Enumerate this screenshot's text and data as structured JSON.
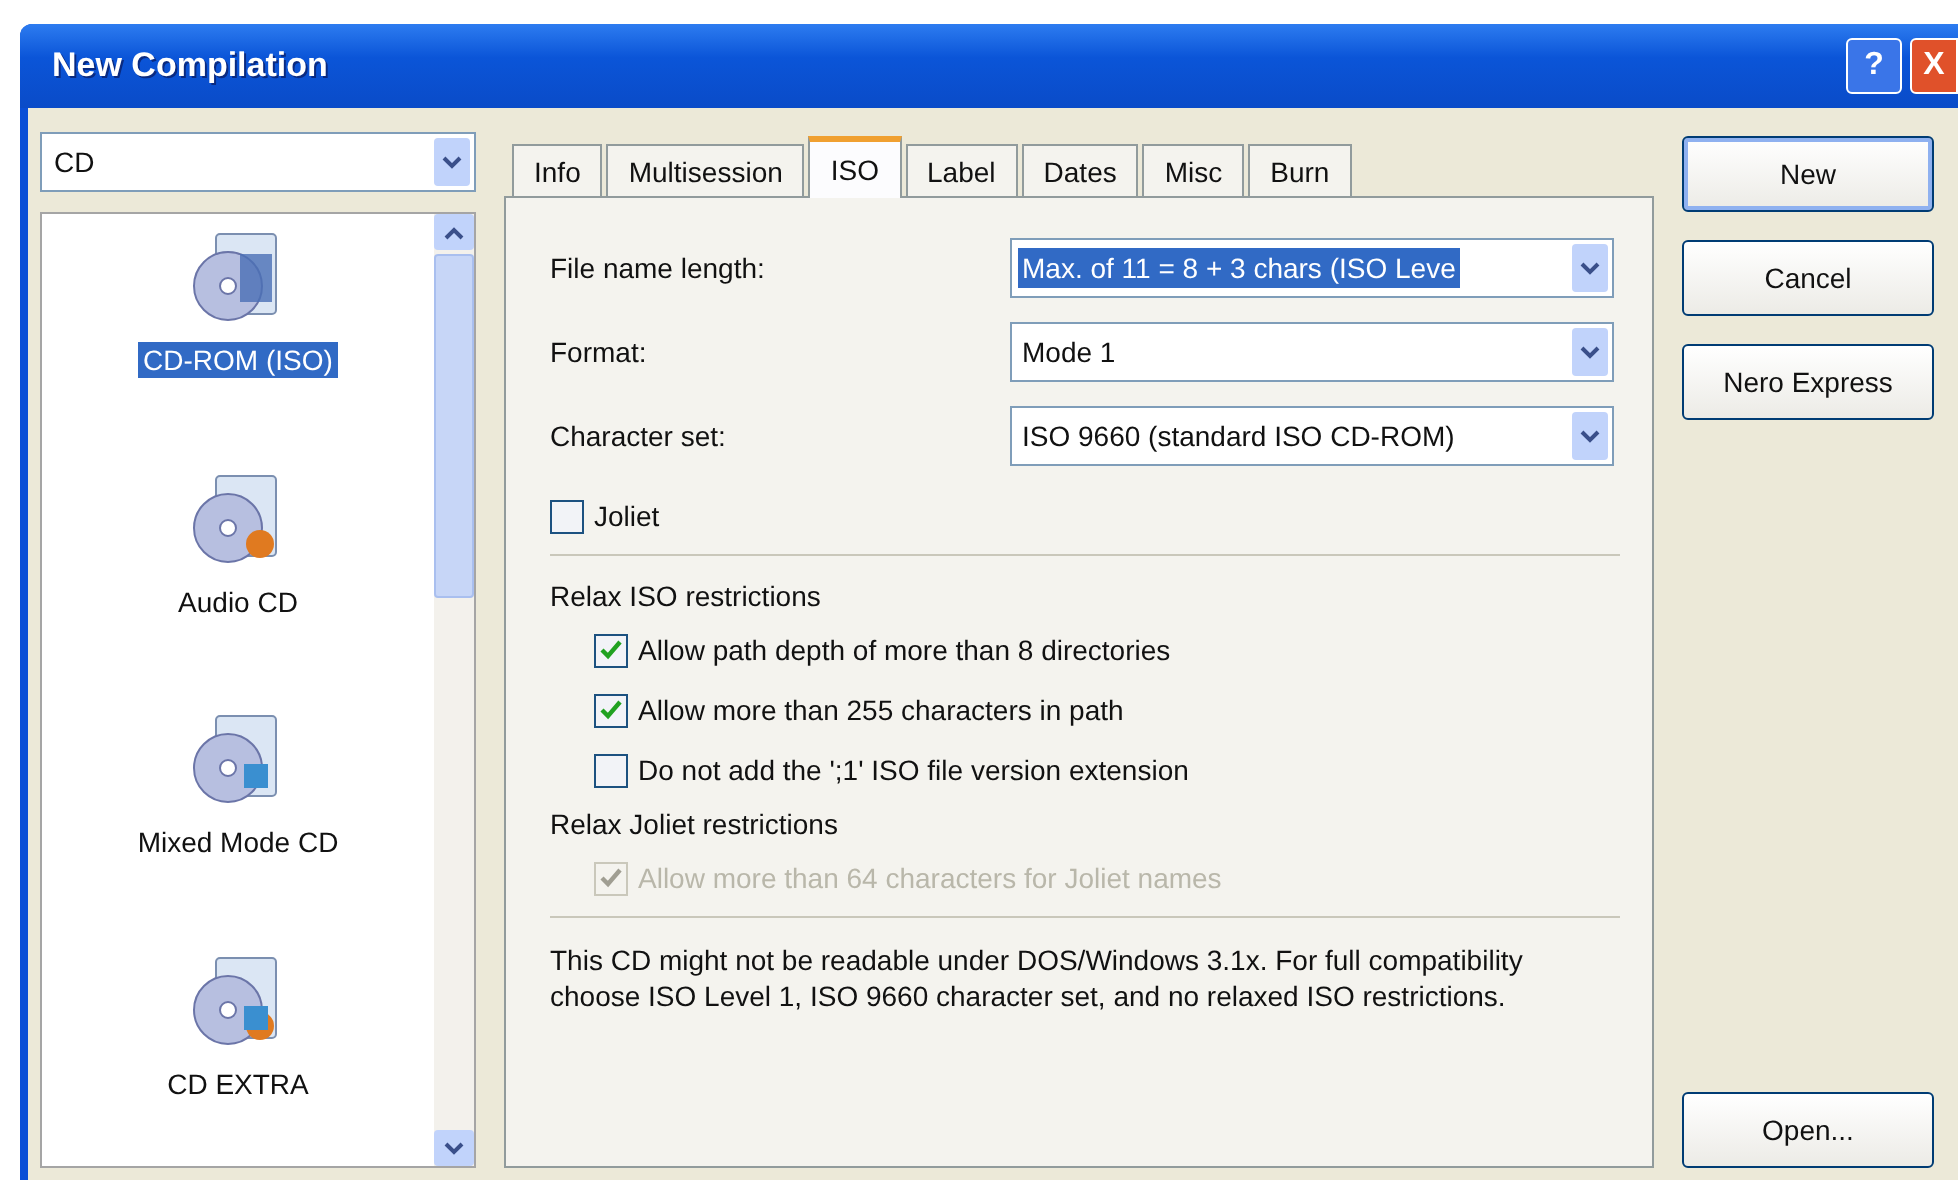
{
  "window": {
    "title": "New Compilation"
  },
  "title_buttons": [
    {
      "kind": "help",
      "label": "?"
    },
    {
      "kind": "close",
      "label": "X"
    }
  ],
  "media_combo": {
    "value": "CD"
  },
  "compilation_types": [
    {
      "label": "CD-ROM (ISO)",
      "selected": true,
      "kind": "data"
    },
    {
      "label": "Audio CD",
      "selected": false,
      "kind": "audio"
    },
    {
      "label": "Mixed Mode CD",
      "selected": false,
      "kind": "mixed"
    },
    {
      "label": "CD EXTRA",
      "selected": false,
      "kind": "extra"
    }
  ],
  "tabs": [
    {
      "label": "Info",
      "selected": false
    },
    {
      "label": "Multisession",
      "selected": false
    },
    {
      "label": "ISO",
      "selected": true
    },
    {
      "label": "Label",
      "selected": false
    },
    {
      "label": "Dates",
      "selected": false
    },
    {
      "label": "Misc",
      "selected": false
    },
    {
      "label": "Burn",
      "selected": false
    }
  ],
  "fields": [
    {
      "label": "File name length:",
      "value": "Max. of 11 = 8 + 3 chars (ISO Leve",
      "highlighted": true
    },
    {
      "label": "Format:",
      "value": "Mode 1",
      "highlighted": false
    },
    {
      "label": "Character set:",
      "value": "ISO 9660 (standard ISO CD-ROM)",
      "highlighted": false
    }
  ],
  "joliet": {
    "label": "Joliet",
    "checked": false,
    "disabled": false
  },
  "iso_group": {
    "title": "Relax ISO restrictions",
    "options": [
      {
        "label": "Allow path depth of more than 8 directories",
        "checked": true,
        "disabled": false
      },
      {
        "label": "Allow more than 255 characters in path",
        "checked": true,
        "disabled": false
      },
      {
        "label": "Do not add the ';1' ISO file version extension",
        "checked": false,
        "disabled": false
      }
    ]
  },
  "joliet_group": {
    "title": "Relax Joliet restrictions",
    "options": [
      {
        "label": "Allow more than 64 characters for Joliet names",
        "checked": true,
        "disabled": true
      }
    ]
  },
  "note": "This CD might not be readable under DOS/Windows 3.1x. For full compatibility choose ISO Level 1, ISO 9660 character set, and no relaxed ISO restrictions.",
  "buttons": [
    {
      "label": "New",
      "default": true
    },
    {
      "label": "Cancel",
      "default": false
    },
    {
      "label": "Nero Express",
      "default": false
    }
  ],
  "bottom_button": {
    "label": "Open..."
  }
}
